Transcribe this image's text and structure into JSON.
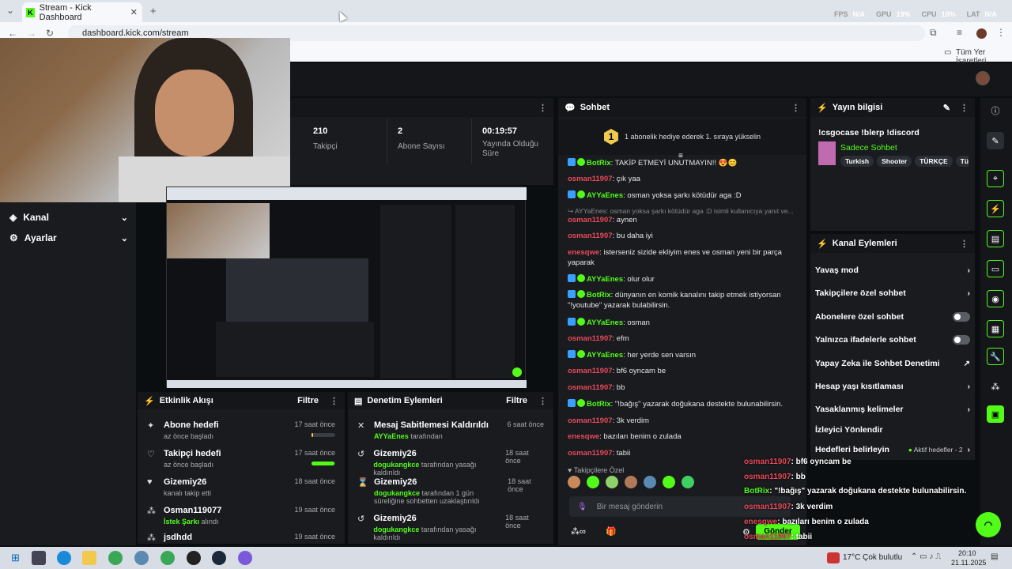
{
  "browser": {
    "tab_title": "Stream - Kick Dashboard",
    "new_tab": "+",
    "url": "dashboard.kick.com/stream",
    "bookmarks_label": "Tüm Yer İşaretleri",
    "perf": {
      "fps_label": "FPS",
      "fps": "N/A",
      "gpu_label": "GPU",
      "gpu": "19%",
      "cpu_label": "CPU",
      "cpu": "18%",
      "lat_label": "LAT",
      "lat": "N/A"
    }
  },
  "sidebar": {
    "items": [
      {
        "label": "Kanal",
        "icon": "layers-icon"
      },
      {
        "label": "Ayarlar",
        "icon": "gear-icon"
      }
    ]
  },
  "stats": [
    {
      "value": "210",
      "label": "Takipçi"
    },
    {
      "value": "2",
      "label": "Abone Sayısı"
    },
    {
      "value": "00:19:57",
      "label": "Yayında Olduğu Süre"
    }
  ],
  "activity": {
    "title": "Etkinlik Akışı",
    "filter": "Filtre",
    "items": [
      {
        "icon": "sparkle-icon",
        "title": "Abone hedefi",
        "sub": "az önce başladı",
        "time": "17 saat önce",
        "progress": 0.05
      },
      {
        "icon": "heart-icon",
        "title": "Takipçi hedefi",
        "sub": "az önce başladı",
        "time": "17 saat önce",
        "progress": 0.95
      },
      {
        "icon": "heart-filled-icon",
        "title": "Gizemiy26",
        "sub": "kanalı takip etti",
        "time": "18 saat önce"
      },
      {
        "icon": "share-icon",
        "title": "Osman119077",
        "sub_hl": "İstek Şarkı",
        "sub": " alındı",
        "time": "19 saat önce"
      },
      {
        "icon": "share-icon",
        "title": "jsdhdd",
        "sub": "",
        "time": "19 saat önce"
      }
    ]
  },
  "moderation": {
    "title": "Denetim Eylemleri",
    "filter": "Filtre",
    "items": [
      {
        "icon": "pin-off-icon",
        "title": "Mesaj Sabitlemesi Kaldırıldı",
        "user": "AYYaEnes",
        "sub": " tarafından",
        "time": "6 saat önce"
      },
      {
        "icon": "undo-icon",
        "title": "Gizemiy26",
        "user": "dogukangkce",
        "sub": " tarafından yasağı kaldırıldı",
        "time": "18 saat önce"
      },
      {
        "icon": "hourglass-icon",
        "title": "Gizemiy26",
        "user": "dogukangkce",
        "sub": " tarafından 1 gün süreliğine sohbetten uzaklaştırıldı",
        "time": "18 saat önce"
      },
      {
        "icon": "undo-icon",
        "title": "Gizemiy26",
        "user": "dogukangkce",
        "sub": " tarafından yasağı kaldırıldı",
        "time": "18 saat önce"
      }
    ]
  },
  "chat": {
    "title": "Sohbet",
    "promo_rank": "1",
    "promo": "1 abonelik hediye ederek 1. sıraya yükselin",
    "messages": [
      {
        "user": "BotRix",
        "color": "#53fc18",
        "bot": true,
        "text": "TAKİP ETMEYİ UNUTMAYIN!! 😍😊"
      },
      {
        "user": "osman11907",
        "color": "#e84a5a",
        "text": "çık yaa"
      },
      {
        "user": "AYYaEnes",
        "color": "#53fc18",
        "mod": true,
        "text": "osman yoksa şarkı kötüdür aga :D"
      },
      {
        "reply": "↪ AYYaEnes: osman yoksa şarkı kötüdür aga :D isimli kullanıcıya yanıt ve..."
      },
      {
        "user": "osman11907",
        "color": "#e84a5a",
        "text": "aynen"
      },
      {
        "user": "osman11907",
        "color": "#e84a5a",
        "text": "bu daha iyi"
      },
      {
        "user": "enesqwe",
        "color": "#e84a5a",
        "text": "isterseniz sizide ekliyim enes ve osman yeni bir parça yaparak"
      },
      {
        "user": "AYYaEnes",
        "color": "#53fc18",
        "mod": true,
        "text": "olur olur"
      },
      {
        "user": "BotRix",
        "color": "#53fc18",
        "bot": true,
        "text": "dünyanın en komik kanalını takip etmek istiyorsan \"!youtube\" yazarak bulabilirsin."
      },
      {
        "user": "AYYaEnes",
        "color": "#53fc18",
        "mod": true,
        "text": "osman"
      },
      {
        "user": "osman11907",
        "color": "#e84a5a",
        "text": "efm"
      },
      {
        "user": "AYYaEnes",
        "color": "#53fc18",
        "mod": true,
        "text": "her yerde sen varsın"
      },
      {
        "user": "osman11907",
        "color": "#e84a5a",
        "text": "bf6 oyncam be"
      },
      {
        "user": "osman11907",
        "color": "#e84a5a",
        "text": "bb"
      },
      {
        "user": "BotRix",
        "color": "#53fc18",
        "bot": true,
        "text": "\"!bağış\" yazarak doğukana destekte bulunabilirsin."
      },
      {
        "user": "osman11907",
        "color": "#e84a5a",
        "text": "3k verdim"
      },
      {
        "user": "enesqwe",
        "color": "#e84a5a",
        "text": "bazıları benim o zulada"
      },
      {
        "user": "osman11907",
        "color": "#e84a5a",
        "text": "tabii"
      }
    ],
    "followers_only": "Takipçilere Özel",
    "input_placeholder": "Bir mesaj gönderin",
    "send": "Gönder"
  },
  "stream_info": {
    "title": "Yayın bilgisi",
    "stream_title": "!csgocase !blerp !discord",
    "category": "Sadece Sohbet",
    "tags": [
      "Turkish",
      "Shooter",
      "TÜRKÇE",
      "Türk"
    ]
  },
  "channel_actions": {
    "title": "Kanal Eylemleri",
    "items": [
      {
        "label": "Yavaş mod",
        "type": "chevron"
      },
      {
        "label": "Takipçilere özel sohbet",
        "type": "chevron"
      },
      {
        "label": "Abonelere özel sohbet",
        "type": "toggle"
      },
      {
        "label": "Yalnızca ifadelerle sohbet",
        "type": "toggle"
      },
      {
        "label": "Yapay Zeka ile Sohbet Denetimi",
        "type": "external"
      },
      {
        "label": "Hesap yaşı kısıtlaması",
        "type": "chevron"
      },
      {
        "label": "Yasaklanmış kelimeler",
        "type": "chevron"
      },
      {
        "label": "İzleyici Yönlendir",
        "type": "none"
      },
      {
        "label": "Hedefleri belirleyin",
        "type": "chevron",
        "extra": "Aktif hedefler - 2"
      }
    ]
  },
  "overlay_chat": [
    {
      "user": "osman11907",
      "text": ": bf6 oyncam be"
    },
    {
      "user": "osman11907",
      "text": ": bb"
    },
    {
      "user": "BotRix",
      "text": ": \"!bağış\" yazarak doğukana destekte bulunabilirsin."
    },
    {
      "user": "osman11907",
      "text": ": 3k verdim"
    },
    {
      "user": "enesqwe",
      "text": ": bazıları benim o zulada"
    },
    {
      "user": "osman11907",
      "text": ": tabii"
    }
  ],
  "taskbar": {
    "weather": "17°C  Çok bulutlu",
    "time": "20:10",
    "date": "21.11.2025"
  },
  "colors": {
    "accent": "#53fc18",
    "bg": "#0b0e11",
    "panel": "#191b1f"
  }
}
